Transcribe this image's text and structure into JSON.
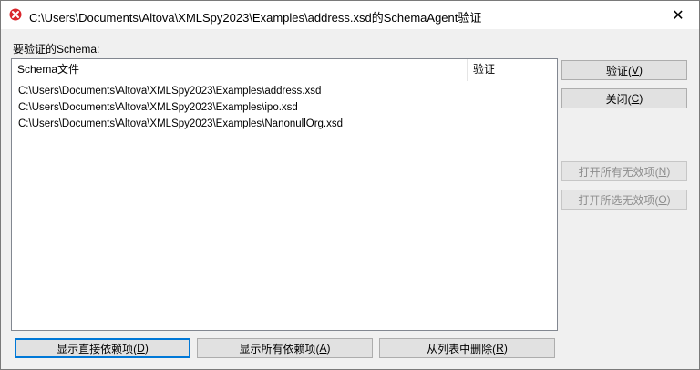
{
  "window": {
    "title": "C:\\Users\\Documents\\Altova\\XMLSpy2023\\Examples\\address.xsd的SchemaAgent验证",
    "close_glyph": "✕"
  },
  "label": "要验证的Schema:",
  "list": {
    "columns": [
      "Schema文件",
      "验证"
    ],
    "rows": [
      "C:\\Users\\Documents\\Altova\\XMLSpy2023\\Examples\\address.xsd",
      "C:\\Users\\Documents\\Altova\\XMLSpy2023\\Examples\\ipo.xsd",
      "C:\\Users\\Documents\\Altova\\XMLSpy2023\\Examples\\NanonullOrg.xsd"
    ]
  },
  "buttons": {
    "validate": {
      "text": "验证(",
      "key": "V",
      "tail": ")"
    },
    "close": {
      "text": "关闭(",
      "key": "C",
      "tail": ")"
    },
    "open_all_invalid": {
      "text": "打开所有无效项(",
      "key": "N",
      "tail": ")"
    },
    "open_selected_invalid": {
      "text": "打开所选无效项(",
      "key": "O",
      "tail": ")"
    },
    "show_direct_deps": {
      "text": "显示直接依赖项(",
      "key": "D",
      "tail": ")"
    },
    "show_all_deps": {
      "text": "显示所有依赖项(",
      "key": "A",
      "tail": ")"
    },
    "remove_from_list": {
      "text": "从列表中删除(",
      "key": "R",
      "tail": ")"
    }
  },
  "colors": {
    "icon_red": "#d9262c",
    "focus_blue": "#0078d7"
  }
}
